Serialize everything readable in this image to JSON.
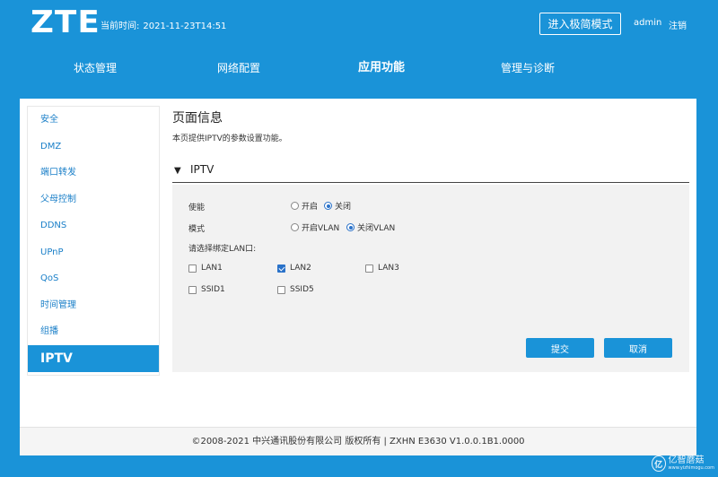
{
  "header": {
    "logo": "ZTE",
    "time_label": "当前时间:",
    "time_value": "2021-11-23T14:51",
    "simple_mode_button": "进入极简模式",
    "user": "admin",
    "logout": "注销"
  },
  "nav": {
    "items": [
      {
        "label": "状态管理"
      },
      {
        "label": "网络配置"
      },
      {
        "label": "应用功能",
        "active": true
      },
      {
        "label": "管理与诊断"
      }
    ]
  },
  "sidebar": {
    "items": [
      {
        "label": "安全"
      },
      {
        "label": "DMZ"
      },
      {
        "label": "端口转发"
      },
      {
        "label": "父母控制"
      },
      {
        "label": "DDNS"
      },
      {
        "label": "UPnP"
      },
      {
        "label": "QoS"
      },
      {
        "label": "时间管理"
      },
      {
        "label": "组播"
      },
      {
        "label": "IPTV",
        "active": true
      }
    ]
  },
  "content": {
    "page_title": "页面信息",
    "page_desc": "本页提供IPTV的参数设置功能。",
    "section_title": "IPTV",
    "enable": {
      "label": "使能",
      "options": [
        "开启",
        "关闭"
      ],
      "selected": "关闭"
    },
    "mode": {
      "label": "模式",
      "options": [
        "开启VLAN",
        "关闭VLAN"
      ],
      "selected": "关闭VLAN"
    },
    "bind_label": "请选择绑定LAN口:",
    "ports": [
      {
        "label": "LAN1",
        "checked": false
      },
      {
        "label": "LAN2",
        "checked": true
      },
      {
        "label": "LAN3",
        "checked": false
      },
      {
        "label": "SSID1",
        "checked": false
      },
      {
        "label": "SSID5",
        "checked": false
      }
    ],
    "submit": "提交",
    "cancel": "取消"
  },
  "footer": {
    "text": "©2008-2021 中兴通讯股份有限公司 版权所有  |   ZXHN E3630 V1.0.0.1B1.0000"
  },
  "watermark": {
    "glyph": "亿",
    "name": "亿智蘑菇",
    "url": "www.yizhimogu.com"
  }
}
